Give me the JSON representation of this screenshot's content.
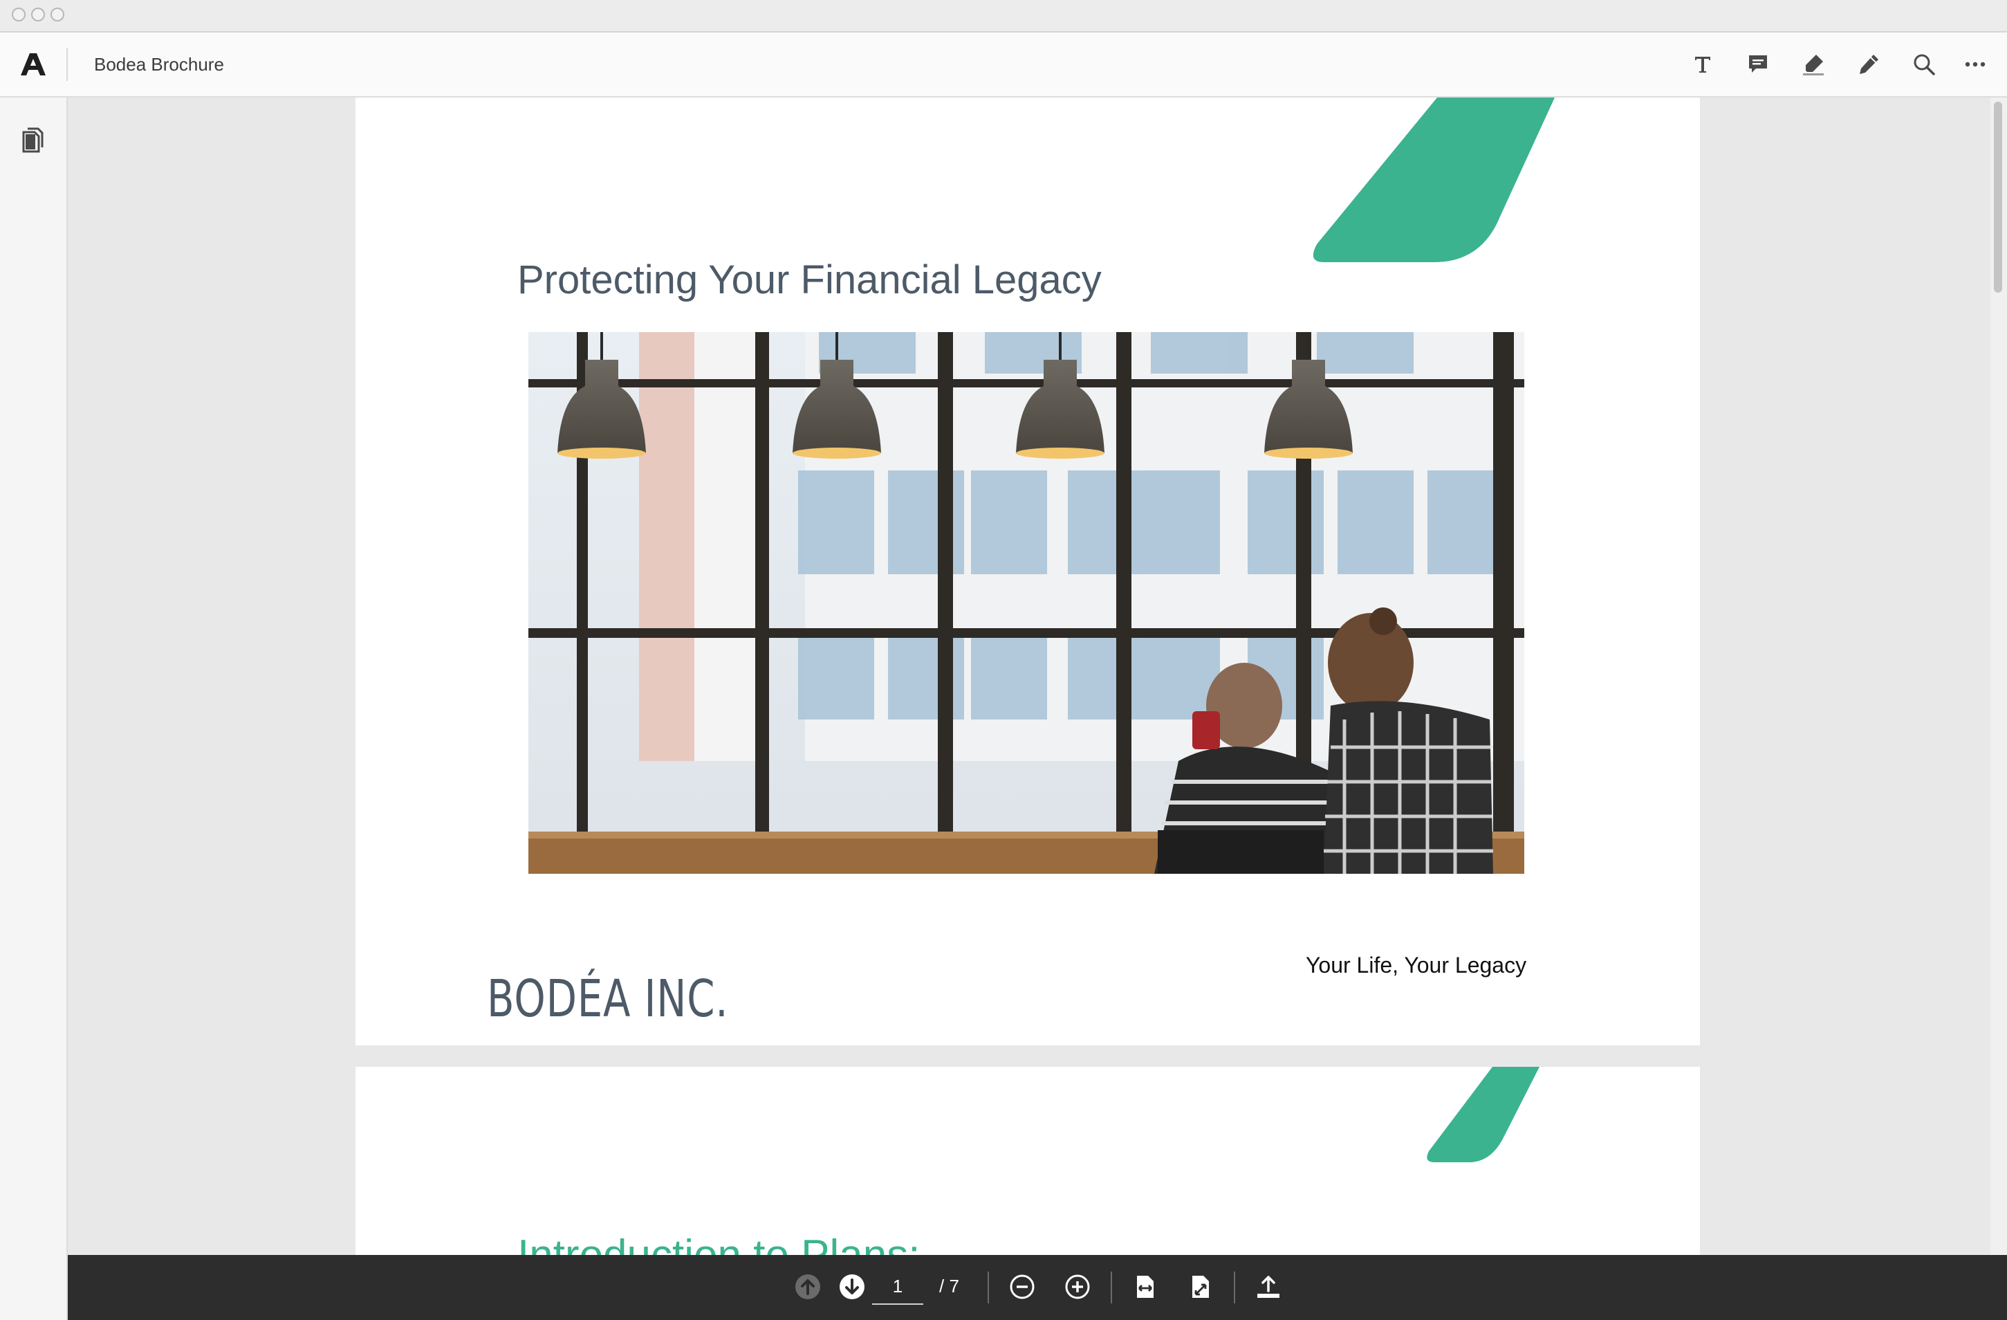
{
  "window": {
    "controls": [
      "close",
      "minimize",
      "zoom"
    ]
  },
  "toolbar": {
    "app_icon": "adobe-acrobat-logo",
    "document_title": "Bodea Brochure",
    "tools": [
      {
        "name": "add-text",
        "icon": "text-icon"
      },
      {
        "name": "comment",
        "icon": "comment-icon"
      },
      {
        "name": "highlight",
        "icon": "highlighter-icon"
      },
      {
        "name": "draw",
        "icon": "pencil-icon"
      },
      {
        "name": "search",
        "icon": "search-icon"
      },
      {
        "name": "more",
        "icon": "more-icon"
      }
    ]
  },
  "left_rail": {
    "items": [
      {
        "name": "page-thumbnails",
        "icon": "pages-icon"
      }
    ]
  },
  "document": {
    "page1": {
      "title": "Protecting Your Financial Legacy",
      "tagline": "Your Life, Your Legacy",
      "brand": "BODÉA INC.",
      "accent_color": "#3bb38f",
      "title_color": "#4d5a68"
    },
    "page2": {
      "heading": "Introduction to Plans:",
      "accent_color": "#3bb38f"
    }
  },
  "page_controls": {
    "current_page": "1",
    "total_label": "/ 7",
    "buttons": [
      {
        "name": "previous-page",
        "icon": "arrow-up-circle-icon",
        "enabled": false
      },
      {
        "name": "next-page",
        "icon": "arrow-down-circle-icon",
        "enabled": true
      },
      {
        "name": "zoom-out",
        "icon": "zoom-out-icon"
      },
      {
        "name": "zoom-in",
        "icon": "zoom-in-icon"
      },
      {
        "name": "fit-width",
        "icon": "fit-width-icon"
      },
      {
        "name": "fit-page",
        "icon": "fit-page-icon"
      },
      {
        "name": "share",
        "icon": "share-icon"
      }
    ]
  },
  "colors": {
    "accent": "#3bb38f",
    "pagebar": "#2d2d2d",
    "toolbar": "#fafafa"
  }
}
